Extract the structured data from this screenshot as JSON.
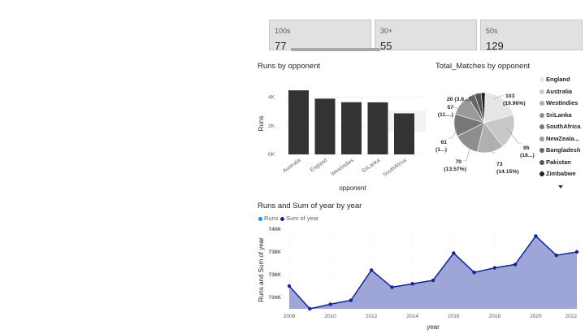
{
  "cards": [
    {
      "label": "100s",
      "value": "77"
    },
    {
      "label": "30+",
      "value": "55"
    },
    {
      "label": "50s",
      "value": "129"
    }
  ],
  "bar_chart": {
    "title": "Runs by opponent",
    "xlabel": "opponent",
    "ylabel": "Runs",
    "yticks": [
      "4K",
      "2K",
      "0K"
    ]
  },
  "pie_chart": {
    "title": "Total_Matches by opponent",
    "labels": [
      {
        "value": "103",
        "pct": "(19.96%)"
      },
      {
        "value": "95",
        "pct": "(18...)"
      },
      {
        "value": "73",
        "pct": "(14.15%)"
      },
      {
        "value": "70",
        "pct": "(13.57%)"
      },
      {
        "value": "61",
        "pct": "(1...)"
      },
      {
        "value": "57",
        "pct": "(11....)"
      },
      {
        "value": "20 (3.8...)",
        "pct": ""
      }
    ],
    "legend": [
      "England",
      "Australia",
      "WestIndies",
      "SriLanka",
      "SouthAfrica",
      "NewZeala...",
      "Bangladesh",
      "Pakistan",
      "Zimbabwe"
    ],
    "legend_colors": [
      "#e6e6e6",
      "#c8c8c8",
      "#b0b0b0",
      "#8e8e8e",
      "#777777",
      "#9a9a9a",
      "#666666",
      "#555555",
      "#222222"
    ],
    "scroll_icon": "caret-down-icon"
  },
  "line_chart": {
    "title": "Runs and Sum of year by year",
    "legend": [
      {
        "label": "Runs",
        "color": "#118dff"
      },
      {
        "label": "Sum of year",
        "color": "#12239e"
      }
    ],
    "xlabel": "year",
    "ylabel": "Runs and Sum of year",
    "yticks": [
      "740K",
      "738K",
      "736K",
      "734K"
    ],
    "xticks": [
      "2008",
      "2010",
      "2012",
      "2014",
      "2016",
      "2018",
      "2020",
      "2022"
    ]
  },
  "chart_data": [
    {
      "type": "bar",
      "title": "Runs by opponent",
      "xlabel": "opponent",
      "ylabel": "Runs",
      "categories": [
        "Australia",
        "England",
        "WestIndies",
        "SriLanka",
        "SouthAfrica"
      ],
      "values": [
        4480,
        3900,
        3650,
        3640,
        2870
      ],
      "ylim": [
        0,
        5000
      ],
      "color": "#333333"
    },
    {
      "type": "pie",
      "title": "Total_Matches by opponent",
      "categories": [
        "England",
        "Australia",
        "WestIndies",
        "SriLanka",
        "SouthAfrica",
        "NewZeala...",
        "Bangladesh",
        "Pakistan",
        "Zimbabwe"
      ],
      "values": [
        103,
        95,
        73,
        70,
        61,
        57,
        20,
        18,
        11
      ]
    },
    {
      "type": "area",
      "title": "Runs and Sum of year by year",
      "xlabel": "year",
      "ylabel": "Runs and Sum of year",
      "x": [
        2008,
        2009,
        2010,
        2011,
        2012,
        2013,
        2014,
        2015,
        2016,
        2017,
        2018,
        2019,
        2020,
        2021,
        2022
      ],
      "series": [
        {
          "name": "Sum of year",
          "values": [
            735000,
            733000,
            733400,
            733750,
            736400,
            734900,
            735200,
            735500,
            737900,
            736200,
            736600,
            736900,
            739400,
            737700,
            738000
          ]
        }
      ],
      "ylim": [
        733000,
        740000
      ],
      "color": "#12239e",
      "fill": "#9ea6d8"
    }
  ]
}
